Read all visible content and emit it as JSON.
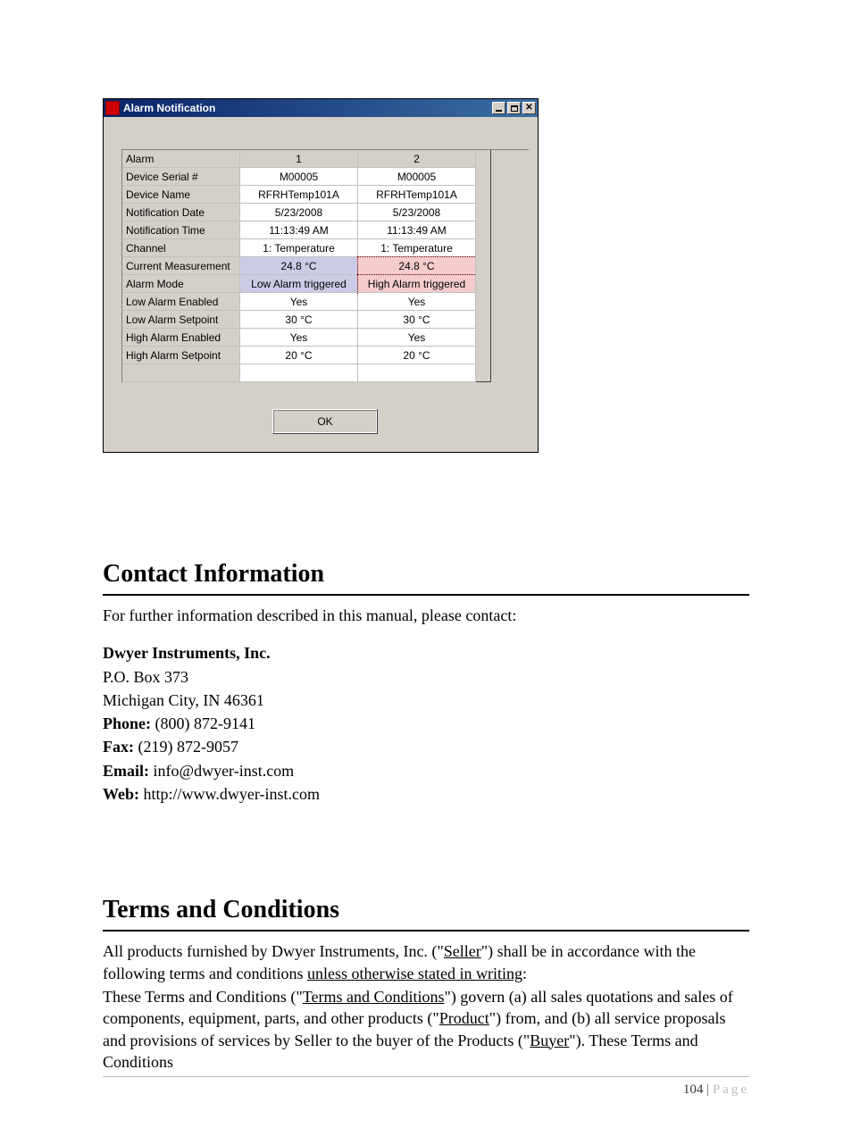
{
  "window": {
    "title": "Alarm Notification",
    "ok_label": "OK",
    "rows": [
      "Alarm",
      "Device Serial #",
      "Device Name",
      "Notification Date",
      "Notification Time",
      "Channel",
      "Current Measurement",
      "Alarm Mode",
      "Low Alarm Enabled",
      "Low Alarm Setpoint",
      "High Alarm Enabled",
      "High Alarm Setpoint"
    ],
    "col1": [
      "1",
      "M00005",
      "RFRHTemp101A",
      "5/23/2008",
      "11:13:49 AM",
      "1:   Temperature",
      "24.8 °C",
      "Low Alarm triggered",
      "Yes",
      "30 °C",
      "Yes",
      "20 °C"
    ],
    "col2": [
      "2",
      "M00005",
      "RFRHTemp101A",
      "5/23/2008",
      "11:13:49 AM",
      "1:   Temperature",
      "24.8 °C",
      "High Alarm triggered",
      "Yes",
      "30 °C",
      "Yes",
      "20 °C"
    ]
  },
  "contact": {
    "heading": "Contact Information",
    "intro": "For further information described in this manual, please contact:",
    "company": "Dwyer Instruments, Inc.",
    "addr1": "P.O. Box 373",
    "addr2": "Michigan City, IN 46361",
    "phone_label": "Phone:",
    "phone": " (800) 872-9141",
    "fax_label": "Fax:",
    "fax": " (219) 872-9057",
    "email_label": "Email:",
    "email": " info@dwyer-inst.com",
    "web_label": "Web:",
    "web": " http://www.dwyer-inst.com"
  },
  "terms": {
    "heading": "Terms and Conditions",
    "p1a": "All products furnished by Dwyer Instruments, Inc. (\"",
    "seller": "Seller",
    "p1b": "\") shall be in accordance with the following terms and conditions ",
    "unless": "unless otherwise stated in writing",
    "p1c": ":",
    "p2a": "These Terms and Conditions (\"",
    "tac": "Terms and Conditions",
    "p2b": "\") govern (a) all sales quotations and sales of components, equipment, parts, and other products (\"",
    "product": "Product",
    "p2c": "\") from, and (b) all service proposals and provisions of services by Seller to the buyer of the Products (\"",
    "buyer": "Buyer",
    "p2d": "\"). These Terms and Conditions"
  },
  "footer": {
    "page_num": "104",
    "sep": " | ",
    "page_word": "Page"
  }
}
